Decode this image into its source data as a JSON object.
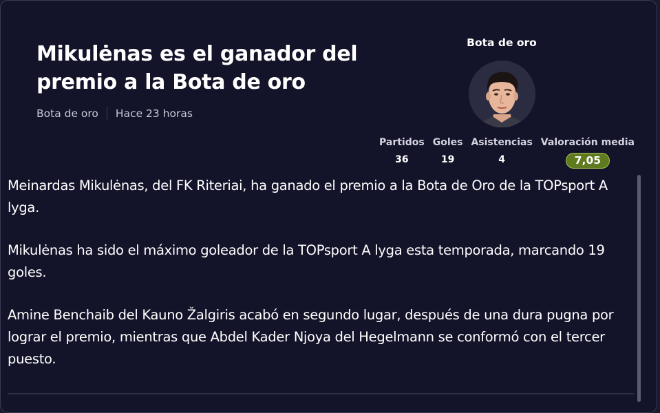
{
  "article": {
    "headline": "Mikulėnas es el ganador del premio a la Bota de oro",
    "category": "Bota de oro",
    "time_ago": "Hace 23 horas",
    "paragraphs": [
      "Meinardas Mikulėnas, del FK Riteriai, ha ganado el premio a la Bota de Oro de la TOPsport A lyga.",
      "Mikulėnas ha sido el máximo goleador de la TOPsport A lyga esta temporada, marcando 19 goles.",
      "Amine Benchaib del Kauno Žalgiris acabó en segundo lugar, después de una dura pugna por lograr el premio, mientras que Abdel Kader Njoya del Hegelmann se conformó con el tercer puesto."
    ]
  },
  "award_card": {
    "title": "Bota de oro",
    "avatar_icon": "player-avatar",
    "stats": {
      "matches_label": "Partidos",
      "matches_value": "36",
      "goals_label": "Goles",
      "goals_value": "19",
      "assists_label": "Asistencias",
      "assists_value": "4",
      "rating_label": "Valoración media",
      "rating_value": "7,05"
    }
  },
  "colors": {
    "background": "#13132a",
    "rating_pill": "#5f7a1f",
    "rating_border": "#a8c45a"
  }
}
